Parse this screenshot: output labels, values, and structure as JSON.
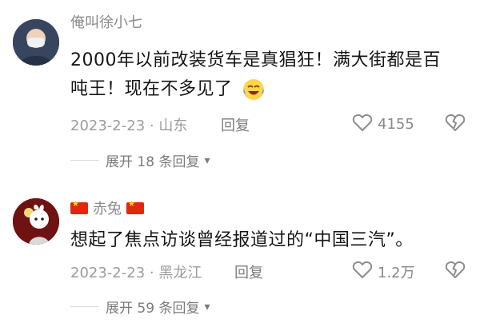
{
  "comments": [
    {
      "username": "俺叫徐小七",
      "text_line1": "2000年以前改装货车是真猖狂！满大街都是百",
      "text_line2": "吨王！现在不多见了",
      "date_location": "2023-2-23 · 山东",
      "reply_label": "回复",
      "likes": "4155",
      "expand_label": "展开 18 条回复"
    },
    {
      "username": "赤兔",
      "text_line1": "想起了焦点访谈曾经报道过的“中国三汽”。",
      "date_location": "2023-2-23 · 黑龙江",
      "reply_label": "回复",
      "likes": "1.2万",
      "expand_label": "展开 59 条回复"
    }
  ],
  "icons": {
    "like": "heart-icon",
    "dislike": "broken-heart-icon",
    "emoji": "crying-laughing-emoji"
  },
  "colors": {
    "text": "#161616",
    "meta": "#9c9c9c",
    "reply": "#7c7c7c",
    "flag": "#de2910"
  }
}
